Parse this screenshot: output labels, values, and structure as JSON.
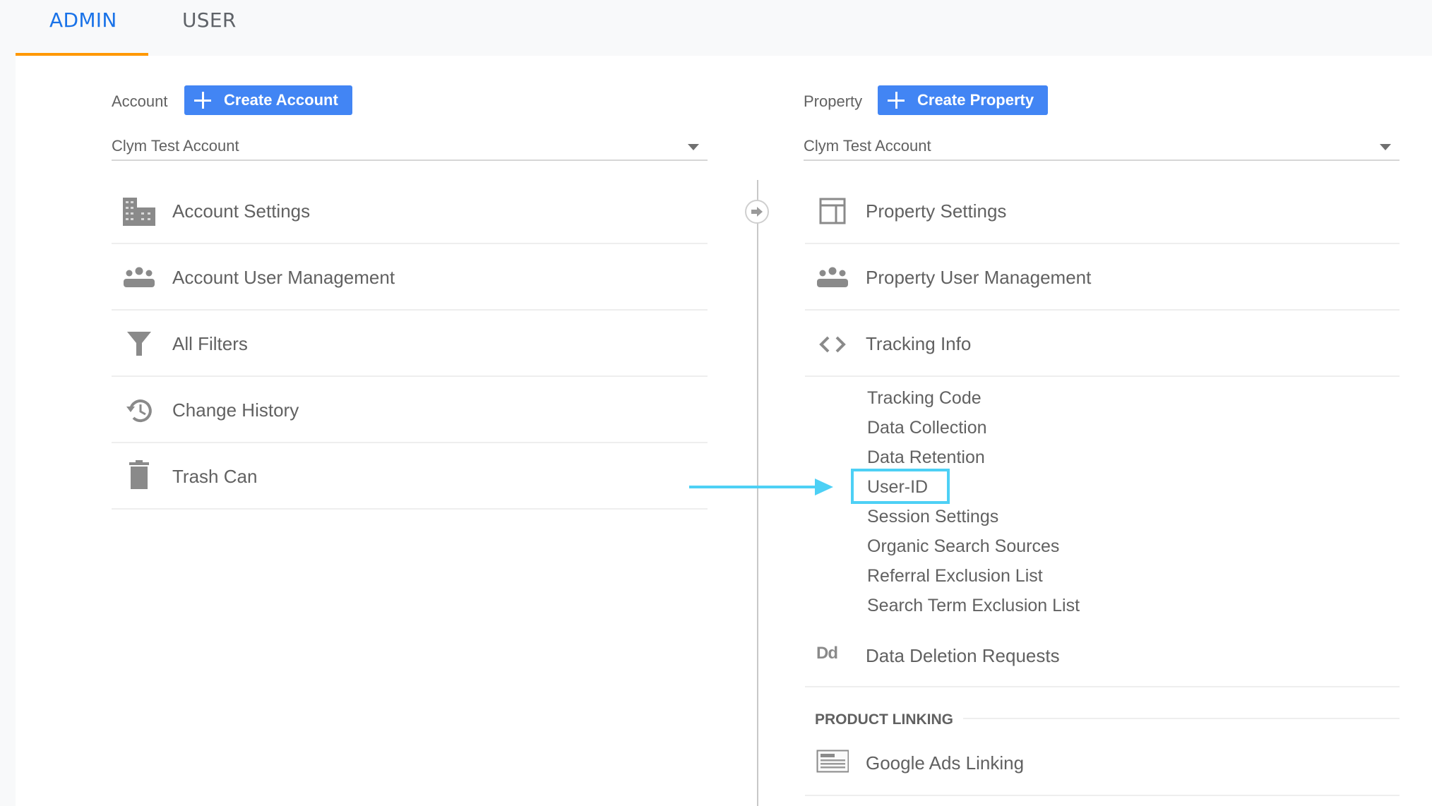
{
  "tabs": [
    {
      "label": "ADMIN",
      "active": true
    },
    {
      "label": "USER",
      "active": false
    }
  ],
  "colors": {
    "accent_blue": "#1a73e8",
    "button_blue": "#4285f4",
    "tab_underline": "#ff9800",
    "annotation_cyan": "#4dd0f5",
    "text_gray": "#616161",
    "icon_gray": "#8a8a8a"
  },
  "account": {
    "header_label": "Account",
    "create_button": "Create Account",
    "selected": "Clym Test Account",
    "items": [
      {
        "label": "Account Settings",
        "icon": "building-icon"
      },
      {
        "label": "Account User Management",
        "icon": "people-icon"
      },
      {
        "label": "All Filters",
        "icon": "filter-icon"
      },
      {
        "label": "Change History",
        "icon": "history-icon"
      },
      {
        "label": "Trash Can",
        "icon": "trash-icon"
      }
    ]
  },
  "property": {
    "header_label": "Property",
    "create_button": "Create Property",
    "selected": "Clym Test Account",
    "items": [
      {
        "label": "Property Settings",
        "icon": "layout-icon"
      },
      {
        "label": "Property User Management",
        "icon": "people-icon"
      },
      {
        "label": "Tracking Info",
        "icon": "code-icon"
      }
    ],
    "tracking_subitems": [
      "Tracking Code",
      "Data Collection",
      "Data Retention",
      "User-ID",
      "Session Settings",
      "Organic Search Sources",
      "Referral Exclusion List",
      "Search Term Exclusion List"
    ],
    "highlighted_subitem": "User-ID",
    "data_deletion": {
      "label": "Data Deletion Requests",
      "icon_text": "Dd"
    },
    "product_linking": {
      "header": "PRODUCT LINKING",
      "items": [
        {
          "label": "Google Ads Linking",
          "icon": "ads-icon"
        }
      ]
    }
  }
}
